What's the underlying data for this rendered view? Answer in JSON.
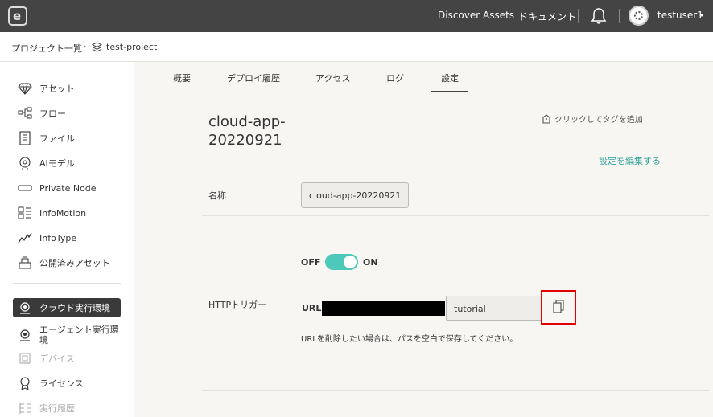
{
  "header": {
    "logo_icon": "e-logo",
    "links": [
      "Discover Assets",
      "ドキュメント"
    ],
    "bell_icon": "bell-icon",
    "user_name": "testuser1"
  },
  "breadcrumb": {
    "root": "プロジェクト一覧",
    "separator": "›",
    "project": "test-project"
  },
  "sidebar": {
    "items": [
      {
        "label": "アセット",
        "icon": "diamond-icon"
      },
      {
        "label": "フロー",
        "icon": "flow-icon"
      },
      {
        "label": "ファイル",
        "icon": "file-icon"
      },
      {
        "label": "AIモデル",
        "icon": "brain-icon"
      },
      {
        "label": "Private Node",
        "icon": "node-icon"
      },
      {
        "label": "InfoMotion",
        "icon": "infomotion-icon"
      },
      {
        "label": "InfoType",
        "icon": "infotype-icon"
      },
      {
        "label": "公開済みアセット",
        "icon": "published-icon"
      },
      {
        "label": "クラウド実行環境",
        "icon": "cloud-runtime-icon",
        "active": true
      },
      {
        "label": "エージェント実行環境",
        "icon": "agent-runtime-icon"
      },
      {
        "label": "デバイス",
        "icon": "device-icon",
        "disabled": true
      },
      {
        "label": "ライセンス",
        "icon": "license-icon"
      },
      {
        "label": "実行履歴",
        "icon": "history-icon",
        "disabled": true
      }
    ]
  },
  "tabs": [
    {
      "label": "概要"
    },
    {
      "label": "デプロイ履歴"
    },
    {
      "label": "アクセス"
    },
    {
      "label": "ログ"
    },
    {
      "label": "設定",
      "active": true
    }
  ],
  "content": {
    "title_line1": "cloud-app-",
    "title_line2": "20220921",
    "tag_add": "クリックしてタグを追加",
    "edit_settings": "設定を編集する",
    "name_label": "名称",
    "name_value": "cloud-app-20220921",
    "http_trigger_label": "HTTPトリガー",
    "toggle_off": "OFF",
    "toggle_on": "ON",
    "toggle_state": true,
    "url_label": "URL:",
    "path_value": "tutorial",
    "url_note": "URLを削除したい場合は、パスを空白で保存してください。"
  },
  "colors": {
    "topbar": "#444444",
    "accent_teal": "#4cc9b9",
    "link_teal": "#2ba196",
    "highlight_red": "#e00000"
  }
}
